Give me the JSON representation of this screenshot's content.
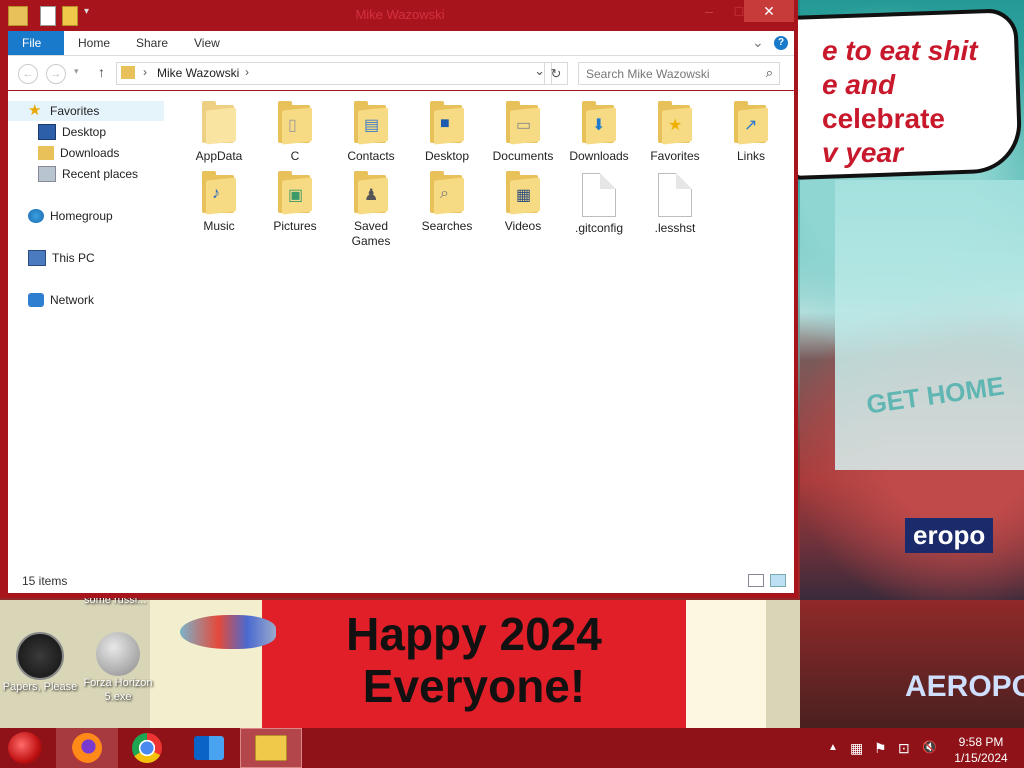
{
  "window": {
    "title": "Mike Wazowski",
    "minimize_icon": "–",
    "maximize_icon": "□",
    "close_icon": "✕"
  },
  "ribbon": {
    "tabs": [
      "File",
      "Home",
      "Share",
      "View"
    ],
    "expand_icon": "⌄",
    "help_icon": "?"
  },
  "address": {
    "back": "←",
    "forward": "→",
    "up": "↑",
    "path": "Mike Wazowski",
    "separator": "›",
    "dropdown": "⌄",
    "refresh": "↻"
  },
  "search": {
    "placeholder": "Search Mike Wazowski",
    "icon": "⌕"
  },
  "navpane": {
    "favorites": "Favorites",
    "desktop": "Desktop",
    "downloads": "Downloads",
    "recent": "Recent places",
    "homegroup": "Homegroup",
    "thispc": "This PC",
    "network": "Network"
  },
  "files": [
    {
      "name": "AppData",
      "kind": "folder",
      "icon": "folder-icon"
    },
    {
      "name": "C",
      "kind": "folder",
      "icon": "folder-document-icon"
    },
    {
      "name": "Contacts",
      "kind": "folder",
      "icon": "contacts-icon"
    },
    {
      "name": "Desktop",
      "kind": "folder",
      "icon": "desktop-icon"
    },
    {
      "name": "Documents",
      "kind": "folder",
      "icon": "documents-icon"
    },
    {
      "name": "Downloads",
      "kind": "folder",
      "icon": "downloads-icon"
    },
    {
      "name": "Favorites",
      "kind": "folder",
      "icon": "star-icon"
    },
    {
      "name": "Links",
      "kind": "folder",
      "icon": "link-icon"
    },
    {
      "name": "Music",
      "kind": "folder",
      "icon": "music-icon"
    },
    {
      "name": "Pictures",
      "kind": "folder",
      "icon": "pictures-icon"
    },
    {
      "name": "Saved Games",
      "kind": "folder",
      "icon": "chess-icon"
    },
    {
      "name": "Searches",
      "kind": "folder",
      "icon": "magnifier-icon"
    },
    {
      "name": "Videos",
      "kind": "folder",
      "icon": "film-icon"
    },
    {
      "name": ".gitconfig",
      "kind": "file",
      "icon": "file-icon"
    },
    {
      "name": ".lesshst",
      "kind": "file",
      "icon": "file-icon"
    }
  ],
  "status": {
    "items": "15 items"
  },
  "wallpaper": {
    "speech_line1": "e to eat shit",
    "speech_line2a": "e and",
    "speech_line2b": "celebrate",
    "speech_line3": "v year",
    "billboard": "GET HOME",
    "sign": "eropo",
    "sign2": "AEROPOS",
    "banner": "Happy 2024\nEveryone!"
  },
  "desktop_icons": {
    "partial_label": "some russi...",
    "papers_please": "Papers, Please",
    "forza": "Forza Horizon 5.exe"
  },
  "taskbar": {
    "apps": [
      "Firefox",
      "Chrome",
      "Outlook",
      "File Explorer"
    ],
    "time": "9:58 PM",
    "date": "1/15/2024",
    "tray_icons": [
      "▲",
      "▦",
      "⚑",
      "⊡",
      "🔇"
    ]
  },
  "colors": {
    "window_frame": "#a8141c",
    "file_tab": "#1979ca",
    "taskbar": "#8e1218",
    "close_button": "#c73b3b",
    "folder": "#e8c15a"
  }
}
